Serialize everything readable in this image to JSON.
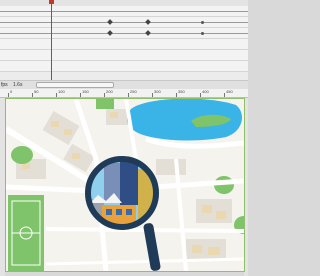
{
  "status": {
    "fps": "fps",
    "time": "1.6s"
  },
  "ruler": {
    "labels": [
      "0",
      "50",
      "100",
      "150",
      "200",
      "250",
      "300",
      "350",
      "400",
      "450",
      "500"
    ]
  },
  "colors": {
    "water": "#3ab3e6",
    "park": "#7fc46a",
    "road": "#ffffff",
    "block": "#dcd8cf",
    "building": "#ead8b0",
    "magnifier": "#1f3b57",
    "playhead": "#c0392b"
  },
  "icons": {
    "magnifier": "magnifier-icon"
  }
}
